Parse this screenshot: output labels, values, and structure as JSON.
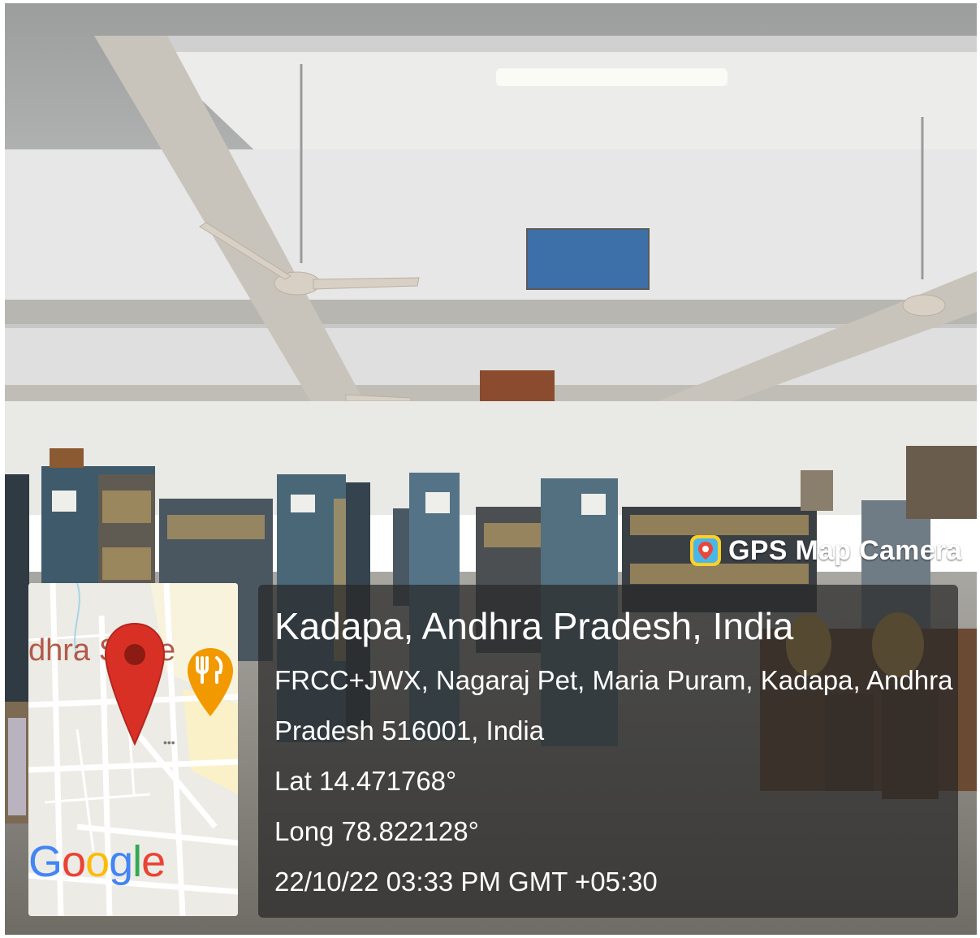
{
  "photo": {
    "description_icons": [
      "ceiling-fan-icon",
      "bookshelf-icon",
      "poster-icon"
    ]
  },
  "watermark": {
    "label": "GPS Map Camera",
    "icon": "gps-map-camera-icon"
  },
  "map": {
    "place_label": "dhra S",
    "place_label_end": "e",
    "logo": "Google",
    "pin_color": "#d93025",
    "restaurant_color": "#f29900"
  },
  "location": {
    "city": "Kadapa, Andhra Pradesh, India",
    "address_line1": "FRCC+JWX, Nagaraj Pet, Maria Puram, Kadapa, Andhra",
    "address_line2": "Pradesh 516001, India",
    "latitude": "Lat 14.471768°",
    "longitude": "Long 78.822128°",
    "timestamp": "22/10/22 03:33 PM GMT +05:30"
  }
}
